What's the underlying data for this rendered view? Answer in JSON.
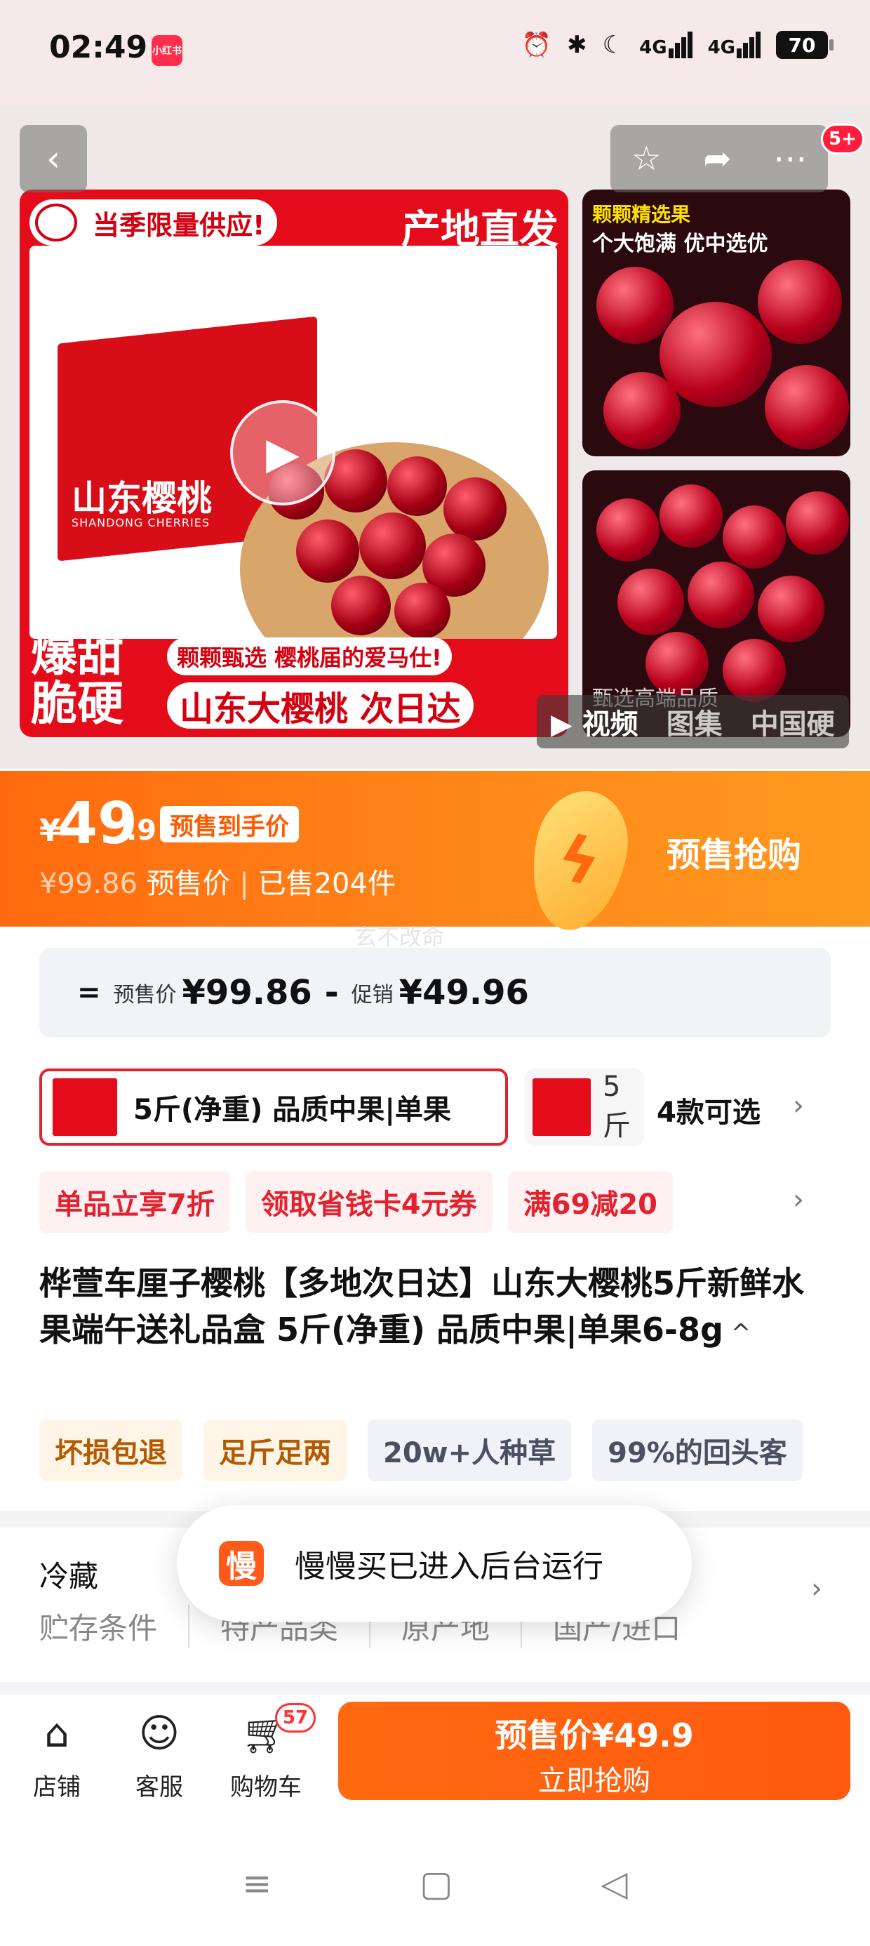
{
  "status_bar": {
    "time": "02:49",
    "app_badge": "小红书",
    "network1": "4G",
    "network2": "4G",
    "battery": "70"
  },
  "gallery": {
    "main": {
      "tag_left": "当季限量供应!",
      "tag_right": "产地直发",
      "box_text": "山东樱桃",
      "box_sub": "SHANDONG CHERRIES",
      "big_left_1": "爆甜",
      "big_left_2": "脆硬",
      "ribbon": "颗颗甄选 樱桃届的爱马仕!",
      "big_right": "山东大樱桃 次日达"
    },
    "side1": {
      "caption1": "颗颗精选果",
      "caption2": "个大饱满 优中选优"
    },
    "side2": {
      "overlay": "甄选高端品质"
    },
    "tabs": {
      "video": "视频",
      "gallery": "图集",
      "extra": "中国硬"
    },
    "more_badge": "5+"
  },
  "price": {
    "currency": "¥",
    "integer": "49",
    "decimal": ".9",
    "tag": "预售到手价",
    "original": "¥99.86",
    "presale_label": "预售价",
    "sold": "已售204件",
    "cta": "预售抢购",
    "watermark": "玄不改命"
  },
  "formula": {
    "eq": "=",
    "label1": "预售价",
    "val1": "¥99.86",
    "minus": "-",
    "label2": "促销",
    "val2": "¥49.96"
  },
  "variants": {
    "selected": "5斤(净重) 品质中果|单果",
    "second": "5斤",
    "count": "4款可选"
  },
  "promos": [
    "单品立享7折",
    "领取省钱卡4元券",
    "满69减20"
  ],
  "title": "桦萱车厘子樱桃【多地次日达】山东大樱桃5斤新鲜水果端午送礼品盒 5斤(净重) 品质中果|单果6-8g",
  "tags": [
    "坏损包退",
    "足斤足两",
    "20w+人种草",
    "99%的回头客"
  ],
  "specs": {
    "storage_value": "冷藏",
    "labels": [
      "贮存条件",
      "特产品类",
      "原产地",
      "国产/进口"
    ]
  },
  "toast": {
    "icon_text": "慢",
    "message": "慢慢买已进入后台运行"
  },
  "bottom_bar": {
    "store": "店铺",
    "service": "客服",
    "cart": "购物车",
    "cart_count": "57",
    "buy_line1": "预售价¥49.9",
    "buy_line2": "立即抢购"
  },
  "colors": {
    "accent": "#ff6a10",
    "promo_red": "#e3222f",
    "brand_red": "#e40c1a"
  }
}
